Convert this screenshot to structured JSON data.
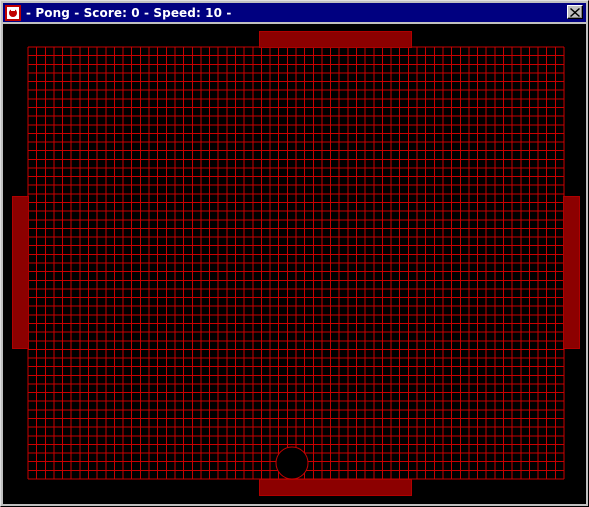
{
  "window": {
    "title": "- Pong - Score: 0 - Speed: 10 -",
    "icon": "pong-app-icon",
    "close_icon": "close-x-icon"
  },
  "game": {
    "score": 0,
    "speed": 10,
    "colors": {
      "background": "#000000",
      "grid": "#c80000",
      "paddle": "#8c0000",
      "paddle_border": "#b00000",
      "ball": "#000000",
      "ball_border": "#c80000"
    },
    "grid": {
      "columns": 62,
      "rows": 50
    },
    "paddles": [
      "top",
      "bottom",
      "left",
      "right"
    ],
    "ball": "bottom-center"
  }
}
